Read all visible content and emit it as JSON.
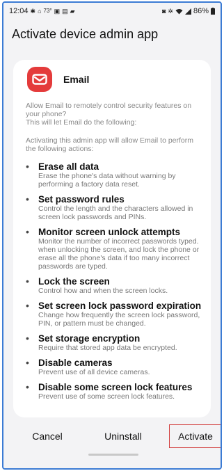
{
  "status_bar": {
    "time": "12:04",
    "left_icons": [
      "notification-icon",
      "notification-icon",
      "temperature-icon",
      "gallery-icon",
      "app-icon",
      "app-icon"
    ],
    "temperature": "73°",
    "battery": "86%",
    "right_icons": [
      "mute-icon",
      "bluetooth-icon",
      "wifi-icon",
      "signal-icon",
      "battery-icon"
    ]
  },
  "header": {
    "title": "Activate device admin app"
  },
  "app": {
    "name": "Email",
    "icon": "mail-icon",
    "icon_color": "#e43b3b"
  },
  "description": {
    "intro": "Allow Email to remotely control security features on your phone?\nThis will let Email do the following:",
    "actions_intro": "Activating this admin app will allow Email to perform the following actions:"
  },
  "permissions": [
    {
      "title": "Erase all data",
      "desc": "Erase the phone's data without warning by performing a factory data reset."
    },
    {
      "title": "Set password rules",
      "desc": "Control the length and the characters allowed in screen lock passwords and PINs."
    },
    {
      "title": "Monitor screen unlock attempts",
      "desc": "Monitor the number of incorrect passwords typed. when unlocking the screen, and lock the phone or erase all the phone's data if too many incorrect passwords are typed."
    },
    {
      "title": "Lock the screen",
      "desc": "Control how and when the screen locks."
    },
    {
      "title": "Set screen lock password expiration",
      "desc": "Change how frequently the screen lock password, PIN, or pattern must be changed."
    },
    {
      "title": "Set storage encryption",
      "desc": "Require that stored app data be encrypted."
    },
    {
      "title": "Disable cameras",
      "desc": "Prevent use of all device cameras."
    },
    {
      "title": "Disable some screen lock features",
      "desc": "Prevent use of some screen lock features."
    }
  ],
  "buttons": {
    "cancel": "Cancel",
    "uninstall": "Uninstall",
    "activate": "Activate"
  },
  "colors": {
    "frame_border": "#3b7bd4",
    "activate_outline": "#d23c3c",
    "background": "#f3f3f5"
  }
}
